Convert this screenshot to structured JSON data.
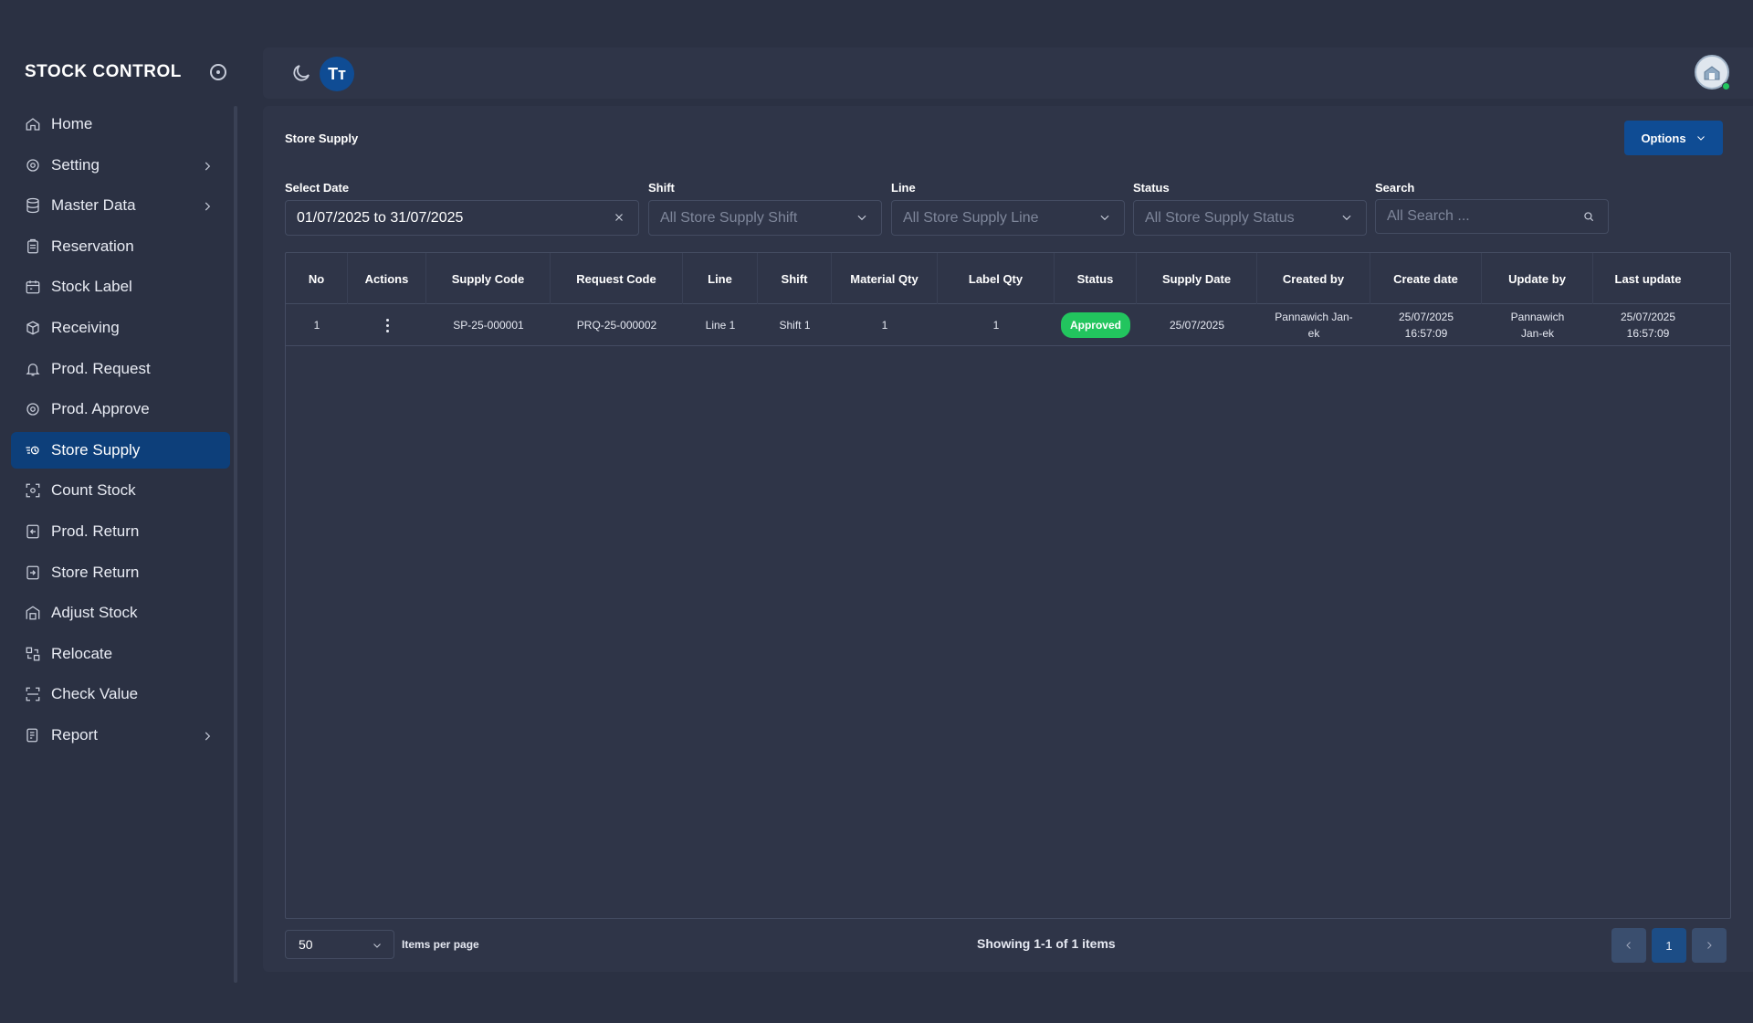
{
  "sidebar": {
    "brand": "STOCK CONTROL",
    "items": [
      {
        "label": "Home",
        "icon": "home-icon",
        "chevron": false,
        "active": false
      },
      {
        "label": "Setting",
        "icon": "gear-icon",
        "chevron": true,
        "active": false
      },
      {
        "label": "Master Data",
        "icon": "database-icon",
        "chevron": true,
        "active": false
      },
      {
        "label": "Reservation",
        "icon": "clipboard-icon",
        "chevron": false,
        "active": false
      },
      {
        "label": "Stock Label",
        "icon": "calendar-label-icon",
        "chevron": false,
        "active": false
      },
      {
        "label": "Receiving",
        "icon": "box-icon",
        "chevron": false,
        "active": false
      },
      {
        "label": "Prod. Request",
        "icon": "bell-icon",
        "chevron": false,
        "active": false
      },
      {
        "label": "Prod. Approve",
        "icon": "gear-check-icon",
        "chevron": false,
        "active": false
      },
      {
        "label": "Store Supply",
        "icon": "truck-icon",
        "chevron": false,
        "active": true
      },
      {
        "label": "Count Stock",
        "icon": "scan-icon",
        "chevron": false,
        "active": false
      },
      {
        "label": "Prod. Return",
        "icon": "return-in-icon",
        "chevron": false,
        "active": false
      },
      {
        "label": "Store Return",
        "icon": "return-out-icon",
        "chevron": false,
        "active": false
      },
      {
        "label": "Adjust Stock",
        "icon": "warehouse-icon",
        "chevron": false,
        "active": false
      },
      {
        "label": "Relocate",
        "icon": "relocate-icon",
        "chevron": false,
        "active": false
      },
      {
        "label": "Check Value",
        "icon": "scan-line-icon",
        "chevron": false,
        "active": false
      },
      {
        "label": "Report",
        "icon": "report-icon",
        "chevron": true,
        "active": false
      }
    ]
  },
  "topbar": {
    "font_button_label": "Tт"
  },
  "page": {
    "title": "Store Supply",
    "options_label": "Options"
  },
  "filters": {
    "date": {
      "label": "Select Date",
      "value": "01/07/2025 to 31/07/2025"
    },
    "shift": {
      "label": "Shift",
      "placeholder": "All Store Supply Shift"
    },
    "line": {
      "label": "Line",
      "placeholder": "All Store Supply Line"
    },
    "status": {
      "label": "Status",
      "placeholder": "All Store Supply Status"
    },
    "search": {
      "label": "Search",
      "placeholder": "All Search ..."
    }
  },
  "table": {
    "columns": [
      "No",
      "Actions",
      "Supply Code",
      "Request Code",
      "Line",
      "Shift",
      "Material Qty",
      "Label Qty",
      "Status",
      "Supply Date",
      "Created by",
      "Create date",
      "Update by",
      "Last update"
    ],
    "rows": [
      {
        "no": "1",
        "supply_code": "SP-25-000001",
        "request_code": "PRQ-25-000002",
        "line": "Line 1",
        "shift": "Shift 1",
        "material_qty": "1",
        "label_qty": "1",
        "status": "Approved",
        "supply_date": "25/07/2025",
        "created_by": "Pannawich Jan-ek",
        "create_date": "25/07/2025 16:57:09",
        "update_by": "Pannawich Jan-ek",
        "last_update": "25/07/2025 16:57:09"
      }
    ]
  },
  "pagination": {
    "per_page": "50",
    "per_page_label": "Items per page",
    "showing": "Showing 1-1 of 1 items",
    "current_page": "1"
  },
  "colors": {
    "background": "#2b3143",
    "panel": "#2f3548",
    "accent": "#0f4c94",
    "active_nav": "#0d3f7a",
    "status_approved": "#22c55e"
  }
}
